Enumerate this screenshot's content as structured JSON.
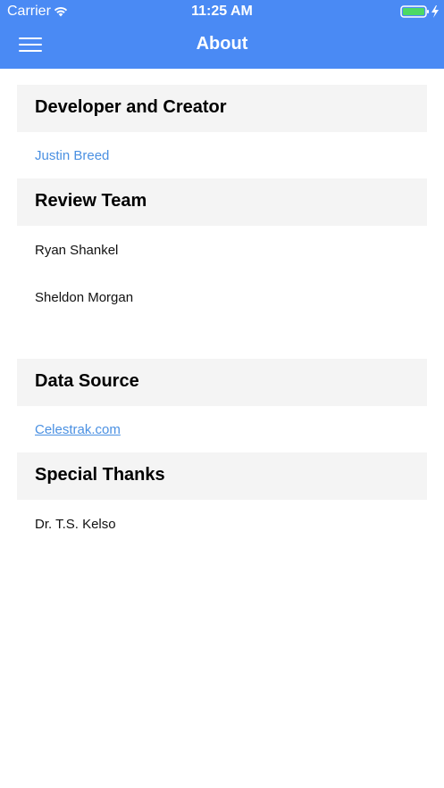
{
  "status_bar": {
    "carrier": "Carrier",
    "time": "11:25 AM",
    "battery_color": "#4cd964"
  },
  "nav": {
    "title": "About",
    "menu_icon": "hamburger-menu-icon",
    "background": "#4a8af4"
  },
  "sections": [
    {
      "title": "Developer and Creator",
      "items": [
        {
          "text": "Justin Breed"
        }
      ]
    },
    {
      "title": "Review Team",
      "items": [
        {
          "text": "Ryan Shankel"
        },
        {
          "text": "Sheldon Morgan"
        }
      ]
    },
    {
      "title": "Data Source",
      "items": [
        {
          "text": "Celestrak.com"
        }
      ]
    },
    {
      "title": "Special Thanks",
      "items": [
        {
          "text": "Dr. T.S. Kelso"
        }
      ]
    }
  ],
  "colors": {
    "accent_link": "#4a90e2",
    "section_header_bg": "#f4f4f4"
  }
}
